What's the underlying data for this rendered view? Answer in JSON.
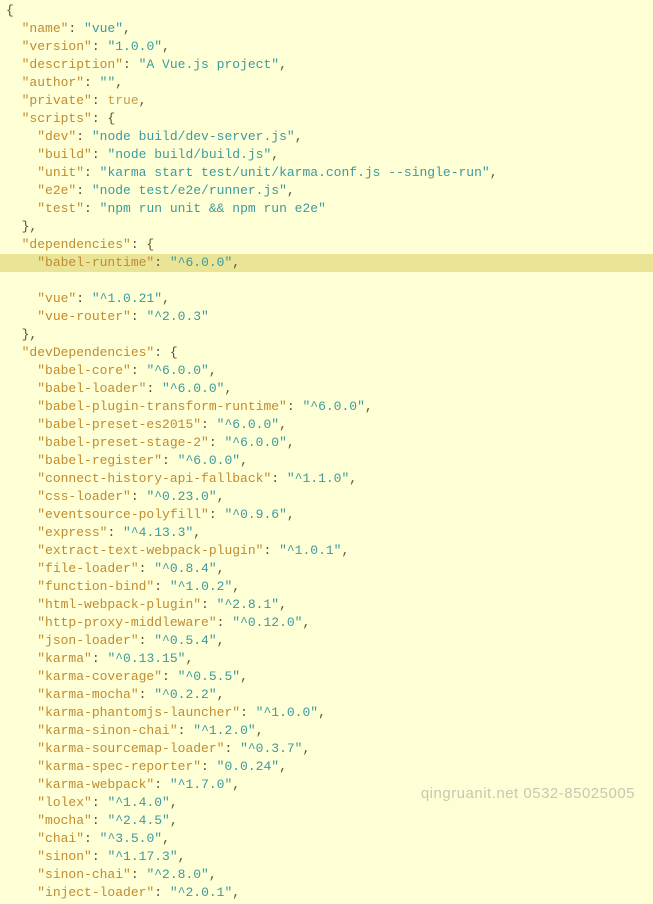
{
  "punct": {
    "open_brace": "{",
    "close_brace": "}",
    "close_brace_comma": "},",
    "colon": ":",
    "comma": ",",
    "quote": "\""
  },
  "root": {
    "name_key": "name",
    "name_val": "vue",
    "version_key": "version",
    "version_val": "1.0.0",
    "description_key": "description",
    "description_val": "A Vue.js project",
    "author_key": "author",
    "author_val": "",
    "private_key": "private",
    "private_val": "true",
    "scripts_key": "scripts",
    "dependencies_key": "dependencies",
    "devDependencies_key": "devDependencies"
  },
  "scripts": {
    "dev_key": "dev",
    "dev_val": "node build/dev-server.js",
    "build_key": "build",
    "build_val": "node build/build.js",
    "unit_key": "unit",
    "unit_val": "karma start test/unit/karma.conf.js --single-run",
    "e2e_key": "e2e",
    "e2e_val": "node test/e2e/runner.js",
    "test_key": "test",
    "test_val": "npm run unit && npm run e2e"
  },
  "deps": {
    "babel_runtime_key": "babel-runtime",
    "babel_runtime_val": "^6.0.0",
    "vue_key": "vue",
    "vue_val": "^1.0.21",
    "vue_router_key": "vue-router",
    "vue_router_val": "^2.0.3"
  },
  "devDeps": {
    "babel_core_key": "babel-core",
    "babel_core_val": "^6.0.0",
    "babel_loader_key": "babel-loader",
    "babel_loader_val": "^6.0.0",
    "babel_plugin_transform_runtime_key": "babel-plugin-transform-runtime",
    "babel_plugin_transform_runtime_val": "^6.0.0",
    "babel_preset_es2015_key": "babel-preset-es2015",
    "babel_preset_es2015_val": "^6.0.0",
    "babel_preset_stage_2_key": "babel-preset-stage-2",
    "babel_preset_stage_2_val": "^6.0.0",
    "babel_register_key": "babel-register",
    "babel_register_val": "^6.0.0",
    "connect_history_api_fallback_key": "connect-history-api-fallback",
    "connect_history_api_fallback_val": "^1.1.0",
    "css_loader_key": "css-loader",
    "css_loader_val": "^0.23.0",
    "eventsource_polyfill_key": "eventsource-polyfill",
    "eventsource_polyfill_val": "^0.9.6",
    "express_key": "express",
    "express_val": "^4.13.3",
    "extract_text_webpack_plugin_key": "extract-text-webpack-plugin",
    "extract_text_webpack_plugin_val": "^1.0.1",
    "file_loader_key": "file-loader",
    "file_loader_val": "^0.8.4",
    "function_bind_key": "function-bind",
    "function_bind_val": "^1.0.2",
    "html_webpack_plugin_key": "html-webpack-plugin",
    "html_webpack_plugin_val": "^2.8.1",
    "http_proxy_middleware_key": "http-proxy-middleware",
    "http_proxy_middleware_val": "^0.12.0",
    "json_loader_key": "json-loader",
    "json_loader_val": "^0.5.4",
    "karma_key": "karma",
    "karma_val": "^0.13.15",
    "karma_coverage_key": "karma-coverage",
    "karma_coverage_val": "^0.5.5",
    "karma_mocha_key": "karma-mocha",
    "karma_mocha_val": "^0.2.2",
    "karma_phantomjs_launcher_key": "karma-phantomjs-launcher",
    "karma_phantomjs_launcher_val": "^1.0.0",
    "karma_sinon_chai_key": "karma-sinon-chai",
    "karma_sinon_chai_val": "^1.2.0",
    "karma_sourcemap_loader_key": "karma-sourcemap-loader",
    "karma_sourcemap_loader_val": "^0.3.7",
    "karma_spec_reporter_key": "karma-spec-reporter",
    "karma_spec_reporter_val": "0.0.24",
    "karma_webpack_key": "karma-webpack",
    "karma_webpack_val": "^1.7.0",
    "lolex_key": "lolex",
    "lolex_val": "^1.4.0",
    "mocha_key": "mocha",
    "mocha_val": "^2.4.5",
    "chai_key": "chai",
    "chai_val": "^3.5.0",
    "sinon_key": "sinon",
    "sinon_val": "^1.17.3",
    "sinon_chai_key": "sinon-chai",
    "sinon_chai_val": "^2.8.0",
    "inject_loader_key": "inject-loader",
    "inject_loader_val": "^2.0.1"
  },
  "watermark": "qingruanit.net 0532-85025005"
}
